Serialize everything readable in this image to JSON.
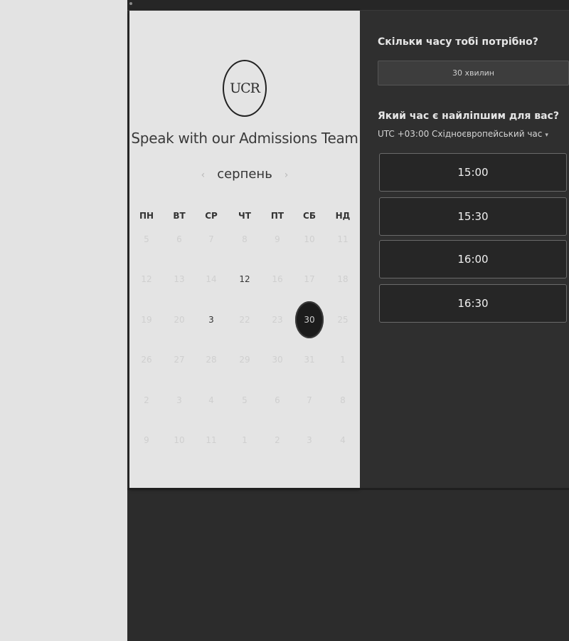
{
  "logo": {
    "text": "UCR"
  },
  "calendar": {
    "title": "Speak with our Admissions Team",
    "month": "серпень",
    "prev_icon": "‹",
    "next_icon": "›",
    "weekdays": [
      "ПН",
      "ВТ",
      "СР",
      "ЧТ",
      "ПТ",
      "СБ",
      "НД"
    ],
    "weeks": [
      [
        {
          "d": "5"
        },
        {
          "d": "6"
        },
        {
          "d": "7"
        },
        {
          "d": "8"
        },
        {
          "d": "9"
        },
        {
          "d": "10"
        },
        {
          "d": "11"
        }
      ],
      [
        {
          "d": "12"
        },
        {
          "d": "13"
        },
        {
          "d": "14"
        },
        {
          "d": "12",
          "available": true
        },
        {
          "d": "16"
        },
        {
          "d": "17"
        },
        {
          "d": "18"
        }
      ],
      [
        {
          "d": "19"
        },
        {
          "d": "20"
        },
        {
          "d": "3",
          "available": true
        },
        {
          "d": "22"
        },
        {
          "d": "23"
        },
        {
          "d": "30",
          "selected": true
        },
        {
          "d": "25"
        }
      ],
      [
        {
          "d": "26"
        },
        {
          "d": "27"
        },
        {
          "d": "28"
        },
        {
          "d": "29"
        },
        {
          "d": "30"
        },
        {
          "d": "31"
        },
        {
          "d": "1"
        }
      ],
      [
        {
          "d": "2"
        },
        {
          "d": "3"
        },
        {
          "d": "4"
        },
        {
          "d": "5"
        },
        {
          "d": "6"
        },
        {
          "d": "7"
        },
        {
          "d": "8"
        }
      ],
      [
        {
          "d": "9"
        },
        {
          "d": "10"
        },
        {
          "d": "11"
        },
        {
          "d": "1"
        },
        {
          "d": "2"
        },
        {
          "d": "3"
        },
        {
          "d": "4"
        }
      ]
    ]
  },
  "booking": {
    "duration_question": "Скільки часу тобі потрібно?",
    "duration_value": "30 хвилин",
    "time_question": "Який час є найліпшим для вас?",
    "timezone": "UTC +03:00 Східноєвропейський час",
    "timezone_caret": "▾",
    "slots": [
      "15:00",
      "15:30",
      "16:00",
      "16:30"
    ]
  }
}
